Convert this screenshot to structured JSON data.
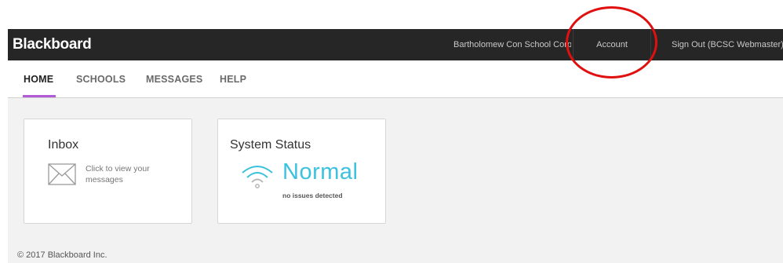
{
  "topbar": {
    "brand": "Blackboard",
    "district": "Bartholomew Con School Corp",
    "account_label": "Account",
    "signout_label": "Sign Out (BCSC Webmaster)"
  },
  "tabs": [
    {
      "label": "HOME",
      "active": true
    },
    {
      "label": "SCHOOLS",
      "active": false
    },
    {
      "label": "MESSAGES",
      "active": false
    },
    {
      "label": "HELP",
      "active": false
    }
  ],
  "inbox": {
    "title": "Inbox",
    "text": "Click to view your messages",
    "icon": "envelope-icon"
  },
  "system_status": {
    "title": "System Status",
    "value": "Normal",
    "subtext": "no issues detected",
    "icon": "wifi-icon",
    "color": "#3cc1de"
  },
  "footer": {
    "copyright": "© 2017 Blackboard Inc."
  },
  "colors": {
    "topbar_bg": "#262626",
    "tab_accent": "#b35bd6",
    "annotation": "#e01010",
    "content_bg": "#f2f2f2"
  }
}
